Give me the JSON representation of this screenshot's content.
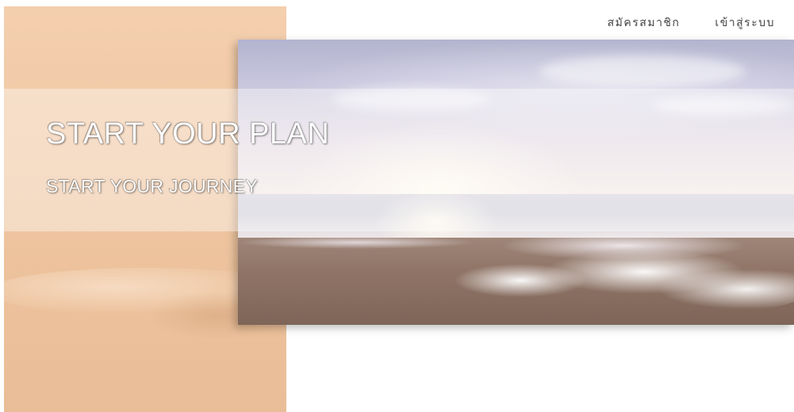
{
  "nav": {
    "register_label": "สมัครสมาชิก",
    "login_label": "เข้าสู่ระบบ"
  },
  "hero": {
    "title": "START YOUR PLAN",
    "subtitle": "START YOUR JOURNEY"
  },
  "colors": {
    "panel_peach": "#efc7a3",
    "nav_text": "#444444",
    "hero_text": "#ffffff"
  }
}
